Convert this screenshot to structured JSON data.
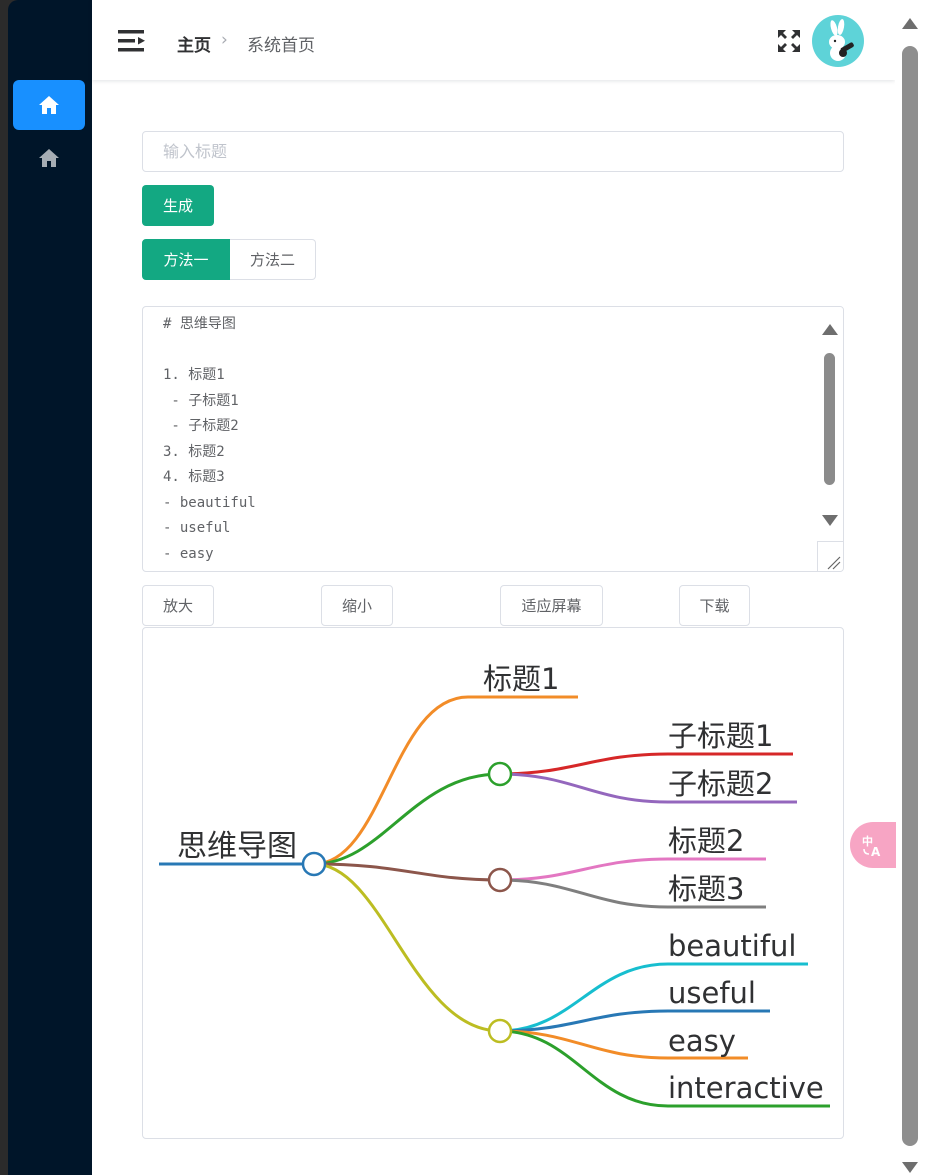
{
  "header": {
    "breadcrumb_home": "主页",
    "breadcrumb_current": "系统首页"
  },
  "form": {
    "title_placeholder": "输入标题",
    "title_value": "",
    "generate_label": "生成",
    "method_tabs": [
      "方法一",
      "方法二"
    ],
    "active_method": "方法一"
  },
  "editor": {
    "content": "# 思维导图\n\n1. 标题1\n - 子标题1\n - 子标题2\n3. 标题2\n4. 标题3\n- beautiful\n- useful\n- easy"
  },
  "toolbar": {
    "zoom_in": "放大",
    "zoom_out": "缩小",
    "fit_screen": "适应屏幕",
    "download": "下载"
  },
  "mindmap": {
    "root": "思维导图",
    "node_title1": "标题1",
    "node_sub1": "子标题1",
    "node_sub2": "子标题2",
    "node_title2": "标题2",
    "node_title3": "标题3",
    "node_beautiful": "beautiful",
    "node_useful": "useful",
    "node_easy": "easy",
    "node_interactive": "interactive"
  },
  "colors": {
    "sidebar_bg": "#001529",
    "nav_active": "#1890ff",
    "primary": "#13a882",
    "avatar_bg": "#5ed3d8",
    "translate_fab": "#f7a5c4"
  },
  "icons": {
    "menu": "menu-fold-icon",
    "home": "home-icon",
    "fullscreen": "fullscreen-icon",
    "translate": "translate-icon"
  }
}
